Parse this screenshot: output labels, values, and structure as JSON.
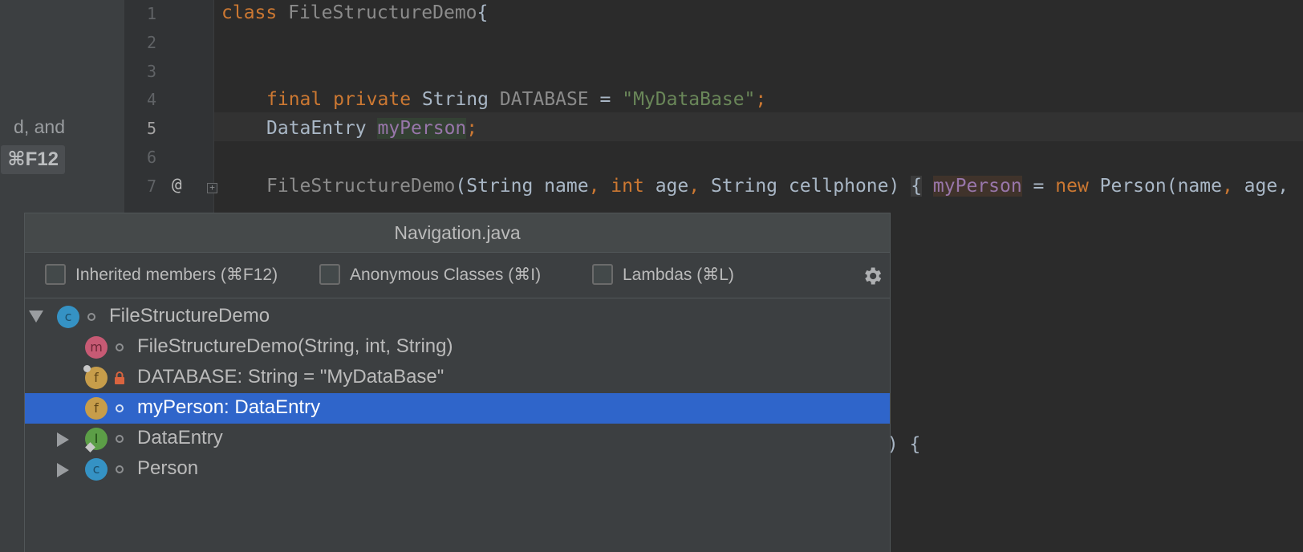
{
  "side_panel": {
    "text": "d, and",
    "shortcut": "⌘F12"
  },
  "gutter": {
    "line_numbers": [
      "1",
      "2",
      "3",
      "4",
      "5",
      "6",
      "7"
    ],
    "override_marker": "@"
  },
  "code": {
    "line1": {
      "kw_class": "class",
      "class_name": "FileStructureDemo",
      "brace": "{"
    },
    "line4": {
      "kw_final": "final",
      "kw_private": "private",
      "type": "String",
      "name": "DATABASE",
      "eq": "=",
      "value": "\"MyDataBase\"",
      "semi": ";"
    },
    "line5": {
      "type": "DataEntry",
      "name": "myPerson",
      "semi": ";"
    },
    "line7": {
      "ctor": "FileStructureDemo",
      "open": "(String name",
      "comma1": ",",
      "kw_int": "int",
      "age": " age",
      "comma2": ",",
      "rest": " String cellphone) ",
      "brace": "{",
      "field": "myPerson",
      "eq": " = ",
      "kw_new": "new",
      "call": " Person(name",
      "comma3": ",",
      "tail": " age,"
    },
    "hidden_fragment": "e) {"
  },
  "popup": {
    "title": "Navigation.java",
    "filters": [
      {
        "label": "Inherited members (⌘F12)",
        "checked": false
      },
      {
        "label": "Anonymous Classes (⌘I)",
        "checked": false
      },
      {
        "label": "Lambdas (⌘L)",
        "checked": false
      }
    ],
    "settings_icon": "gear-icon",
    "tree": [
      {
        "label": "FileStructureDemo",
        "icon": "class-icon",
        "glyph": "c",
        "expanded": true,
        "level": 0,
        "visibility": "package-private"
      },
      {
        "label": "FileStructureDemo(String, int, String)",
        "icon": "method-icon",
        "glyph": "m",
        "level": 1,
        "visibility": "package-private"
      },
      {
        "label": "DATABASE: String = \"MyDataBase\"",
        "icon": "field-icon",
        "glyph": "f",
        "level": 1,
        "visibility": "private",
        "final": true
      },
      {
        "label": "myPerson: DataEntry",
        "icon": "field-icon",
        "glyph": "f",
        "level": 1,
        "visibility": "package-private",
        "selected": true
      },
      {
        "label": "DataEntry",
        "icon": "interface-icon",
        "glyph": "I",
        "level": 1,
        "collapsed": true,
        "visibility": "package-private"
      },
      {
        "label": "Person",
        "icon": "class-icon",
        "glyph": "c",
        "level": 1,
        "collapsed": true,
        "visibility": "package-private"
      }
    ]
  },
  "colors": {
    "editor_bg": "#2b2b2b",
    "popup_bg": "#3c3f41",
    "selection": "#2f65ca",
    "keyword": "#cc7832",
    "string": "#6a8759",
    "field": "#9876aa"
  }
}
